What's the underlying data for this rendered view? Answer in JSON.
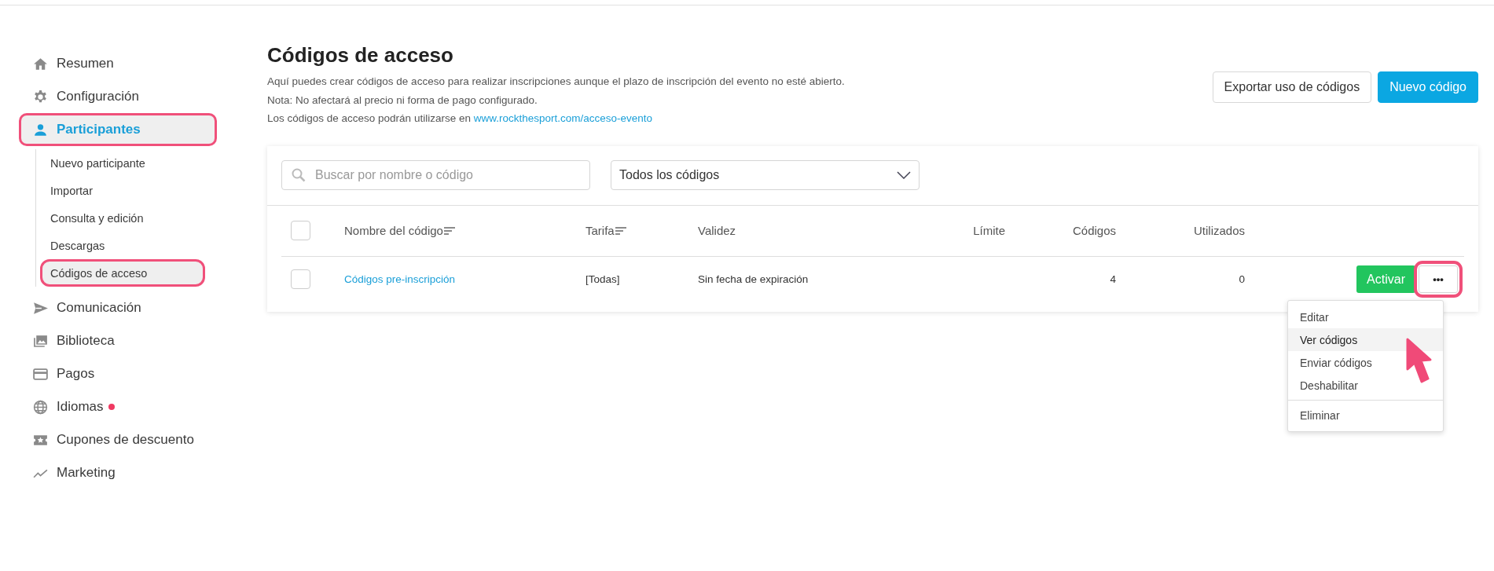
{
  "sidebar": {
    "items": [
      {
        "label": "Resumen",
        "selected": false,
        "highlighted": false
      },
      {
        "label": "Configuración",
        "selected": false,
        "highlighted": false
      },
      {
        "label": "Participantes",
        "selected": true,
        "highlighted": true,
        "children": [
          {
            "label": "Nuevo participante",
            "selected": false,
            "highlighted": false
          },
          {
            "label": "Importar",
            "selected": false,
            "highlighted": false
          },
          {
            "label": "Consulta y edición",
            "selected": false,
            "highlighted": false
          },
          {
            "label": "Descargas",
            "selected": false,
            "highlighted": false
          },
          {
            "label": "Códigos de acceso",
            "selected": true,
            "highlighted": true
          }
        ]
      },
      {
        "label": "Comunicación",
        "selected": false,
        "highlighted": false
      },
      {
        "label": "Biblioteca",
        "selected": false,
        "highlighted": false
      },
      {
        "label": "Pagos",
        "selected": false,
        "highlighted": false
      },
      {
        "label": "Idiomas",
        "selected": false,
        "highlighted": false,
        "notification": true
      },
      {
        "label": "Cupones de descuento",
        "selected": false,
        "highlighted": false
      },
      {
        "label": "Marketing",
        "selected": false,
        "highlighted": false
      }
    ]
  },
  "header": {
    "title": "Códigos de acceso",
    "lines": [
      "Aquí puedes crear códigos de acceso para realizar inscripciones aunque el plazo de inscripción del evento no esté abierto.",
      "Nota: No afectará al precio ni forma de pago configurado."
    ],
    "link_line": {
      "text": "Los códigos de acceso podrán utilizarse en",
      "link": "www.rockthesport.com/acceso-evento"
    },
    "buttons": [
      {
        "label": "Exportar uso de códigos",
        "kind": "secondary"
      },
      {
        "label": "Nuevo código",
        "kind": "primary"
      }
    ]
  },
  "filters": {
    "search": {
      "placeholder": "Buscar por nombre o código"
    },
    "dropdown": {
      "value": "Todos los códigos"
    }
  },
  "table": {
    "select_all": {
      "checked": false
    },
    "columns": [
      {
        "label": "Nombre del código",
        "sortable": true
      },
      {
        "label": "Tarifa",
        "sortable": true
      },
      {
        "label": "Validez"
      },
      {
        "label": "Límite"
      },
      {
        "label": "Códigos"
      },
      {
        "label": "Utilizados"
      }
    ],
    "rows": [
      {
        "checked": false,
        "name": "Códigos pre-inscripción",
        "tarifa": "[Todas]",
        "validez": "Sin fecha de expiración",
        "codigos": "4",
        "utilizados": "0",
        "action": "Activar",
        "more": "•••",
        "more_highlighted": true,
        "menu": [
          [
            {
              "label": "Editar",
              "selected": false
            },
            {
              "label": "Ver códigos",
              "selected": true
            },
            {
              "label": "Enviar códigos",
              "selected": false
            },
            {
              "label": "Deshabilitar",
              "selected": false
            }
          ],
          [
            {
              "label": "Eliminar",
              "selected": false
            }
          ]
        ]
      }
    ]
  }
}
